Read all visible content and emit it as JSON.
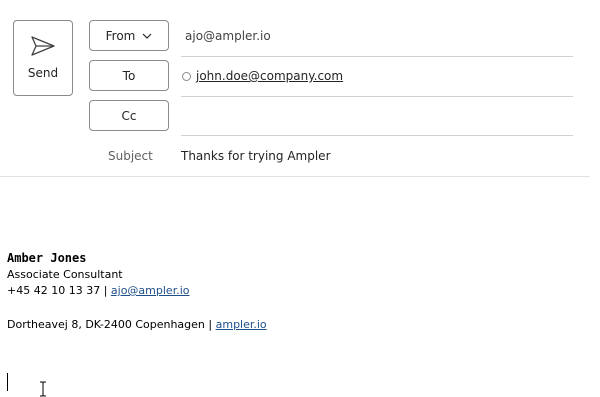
{
  "toolbar": {
    "send_label": "Send"
  },
  "fields": {
    "from_label": "From",
    "from_value": "ajo@ampler.io",
    "to_label": "To",
    "to_recipients": [
      "john.doe@company.com"
    ],
    "cc_label": "Cc",
    "cc_value": "",
    "subject_label": "Subject",
    "subject_value": "Thanks for trying Ampler"
  },
  "signature": {
    "name": "Amber Jones",
    "title": "Associate Consultant",
    "phone": "+45 42 10 13 37",
    "separator": " | ",
    "email": "ajo@ampler.io",
    "address": "Dortheavej 8, DK-2400 Copenhagen",
    "website": "ampler.io"
  },
  "icons": {
    "send": "send-icon",
    "from_dropdown": "chevron-down-icon",
    "recipient_status": "presence-circle-icon",
    "cursor": "text-cursor-icon"
  },
  "colors": {
    "border": "#8a8a8a",
    "divider": "#d1d1d1",
    "link": "#1f4f8a",
    "label_muted": "#616161"
  }
}
